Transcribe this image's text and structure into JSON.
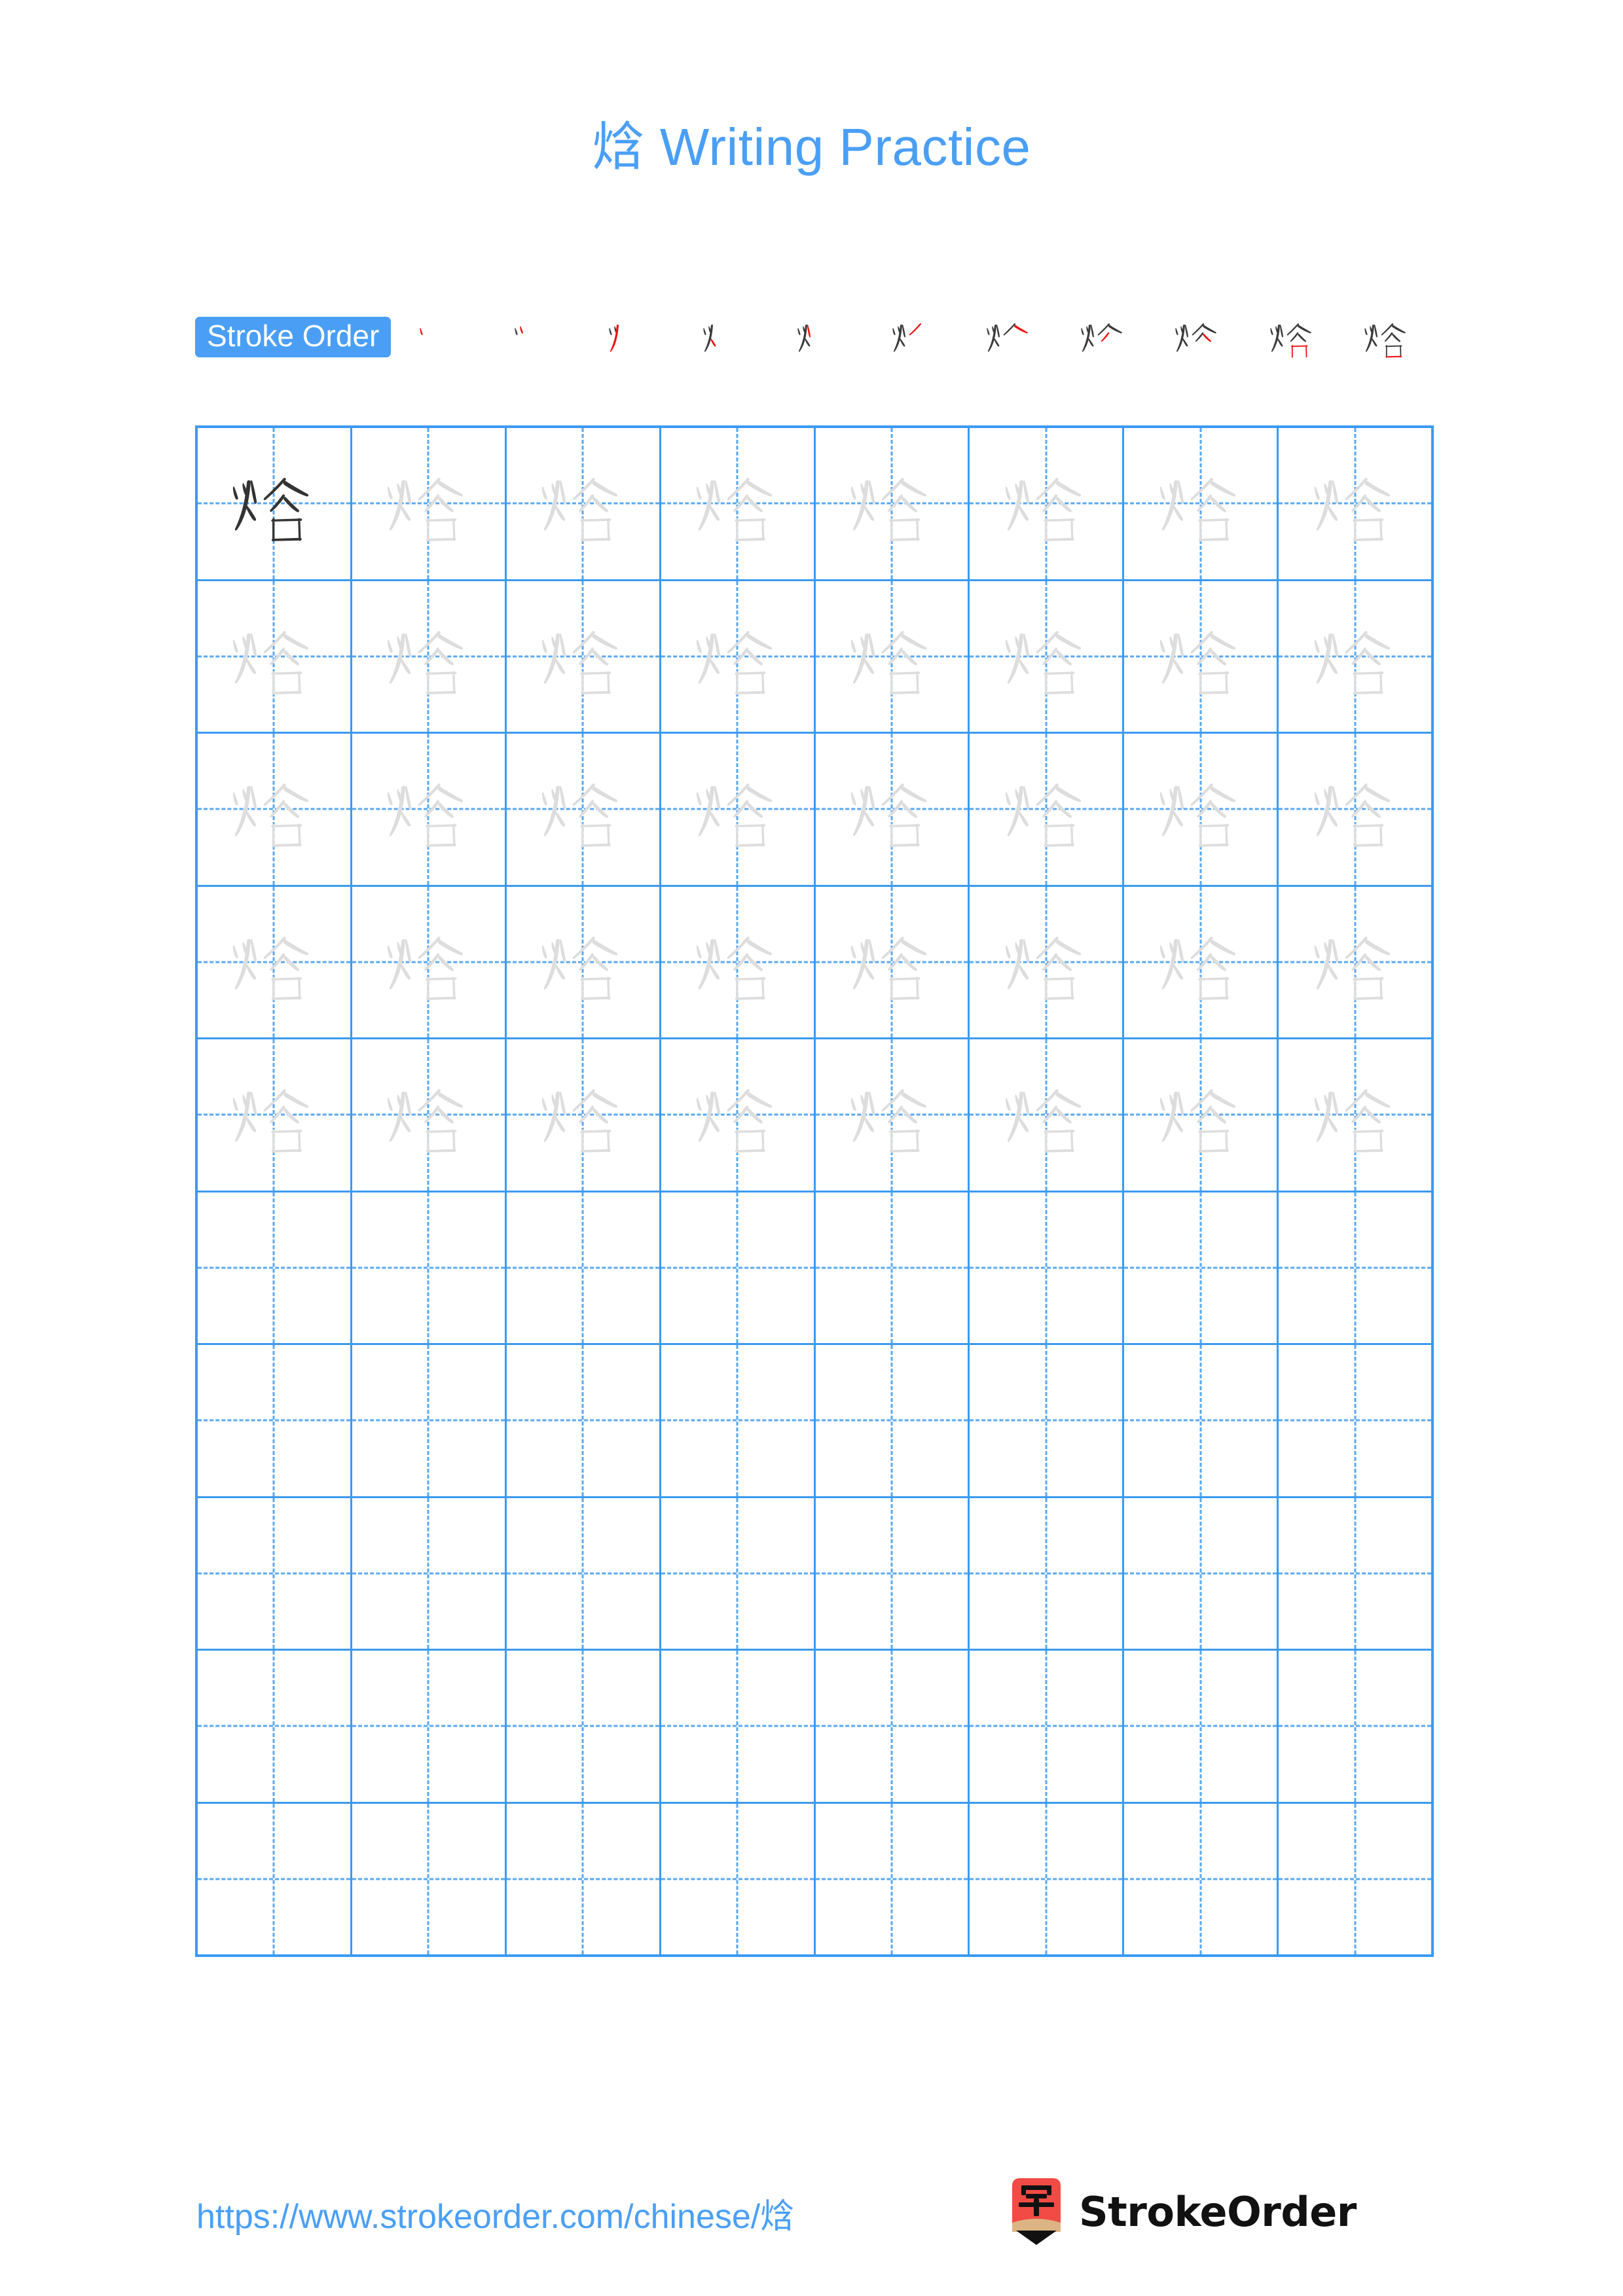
{
  "page": {
    "character": "焓",
    "title": "焓 Writing Practice",
    "background_color": "#ffffff"
  },
  "stroke_order": {
    "badge_label": "Stroke Order",
    "badge_bg_color": "#4A9FF5",
    "badge_text_color": "#ffffff",
    "total_strokes": 11,
    "new_stroke_color": "#ee1111",
    "existing_stroke_color": "#3a3a3a",
    "steps": [
      {
        "index": 1,
        "partial": "丶"
      },
      {
        "index": 2,
        "partial": "丷"
      },
      {
        "index": 3,
        "partial": "少"
      },
      {
        "index": 4,
        "partial": "火"
      },
      {
        "index": 5,
        "partial": "灯"
      },
      {
        "index": 6,
        "partial": "炏"
      },
      {
        "index": 7,
        "partial": "炏"
      },
      {
        "index": 8,
        "partial": "焓"
      },
      {
        "index": 9,
        "partial": "焓"
      },
      {
        "index": 10,
        "partial": "焓"
      },
      {
        "index": 11,
        "partial": "焓"
      }
    ]
  },
  "practice_grid": {
    "columns": 8,
    "rows": 10,
    "border_color": "#3B9AF0",
    "guide_color": "#58A8F2",
    "model_char_color": "#333333",
    "trace_char_color": "#dddddd",
    "cells": [
      [
        "焓",
        "焓",
        "焓",
        "焓",
        "焓",
        "焓",
        "焓",
        "焓"
      ],
      [
        "焓",
        "焓",
        "焓",
        "焓",
        "焓",
        "焓",
        "焓",
        "焓"
      ],
      [
        "焓",
        "焓",
        "焓",
        "焓",
        "焓",
        "焓",
        "焓",
        "焓"
      ],
      [
        "焓",
        "焓",
        "焓",
        "焓",
        "焓",
        "焓",
        "焓",
        "焓"
      ],
      [
        "焓",
        "焓",
        "焓",
        "焓",
        "焓",
        "焓",
        "焓",
        "焓"
      ],
      [
        "",
        "",
        "",
        "",
        "",
        "",
        "",
        ""
      ],
      [
        "",
        "",
        "",
        "",
        "",
        "",
        "",
        ""
      ],
      [
        "",
        "",
        "",
        "",
        "",
        "",
        "",
        ""
      ],
      [
        "",
        "",
        "",
        "",
        "",
        "",
        "",
        ""
      ],
      [
        "",
        "",
        "",
        "",
        "",
        "",
        "",
        ""
      ]
    ],
    "model_cell": {
      "row": 0,
      "column": 0
    }
  },
  "footer": {
    "url": "https://www.strokeorder.com/chinese/焓",
    "url_color": "#4A9FF5",
    "brand_name": "StrokeOrder",
    "logo": {
      "icon_name": "pencil-zi-logo",
      "body_color": "#F24A45",
      "wood_color": "#DDB584",
      "tip_color": "#111111",
      "glyph": "字"
    }
  }
}
